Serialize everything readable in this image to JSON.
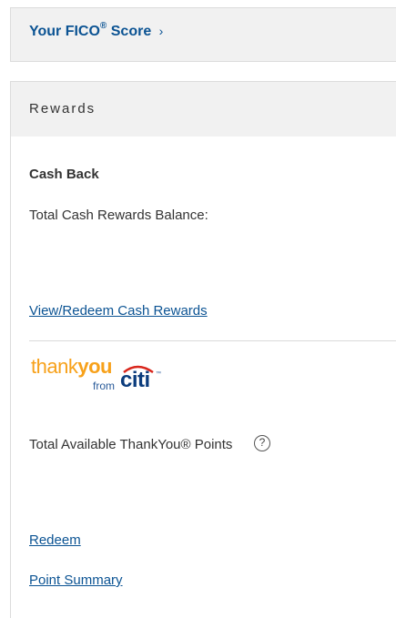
{
  "fico": {
    "label": "Your FICO",
    "registered": "®",
    "suffix": "Score",
    "chevron": "›"
  },
  "rewards": {
    "header": "Rewards",
    "cash_back": {
      "title": "Cash Back",
      "balance_label": "Total Cash Rewards Balance:",
      "redeem_link": "View/Redeem Cash Rewards"
    },
    "thankyou": {
      "logo_thank": "thank",
      "logo_you": "you",
      "logo_from": "from",
      "logo_citi": "citi",
      "logo_tm": "™",
      "points_label": "Total Available ThankYou® Points",
      "help_icon_glyph": "?",
      "redeem_link": "Redeem",
      "summary_link": "Point Summary"
    }
  },
  "colors": {
    "link": "#0b5393",
    "header_bg": "#f1f1f1",
    "thankyou_orange": "#f7a11a",
    "citi_blue": "#0b3c7d",
    "citi_arc_red": "#d9261c"
  }
}
